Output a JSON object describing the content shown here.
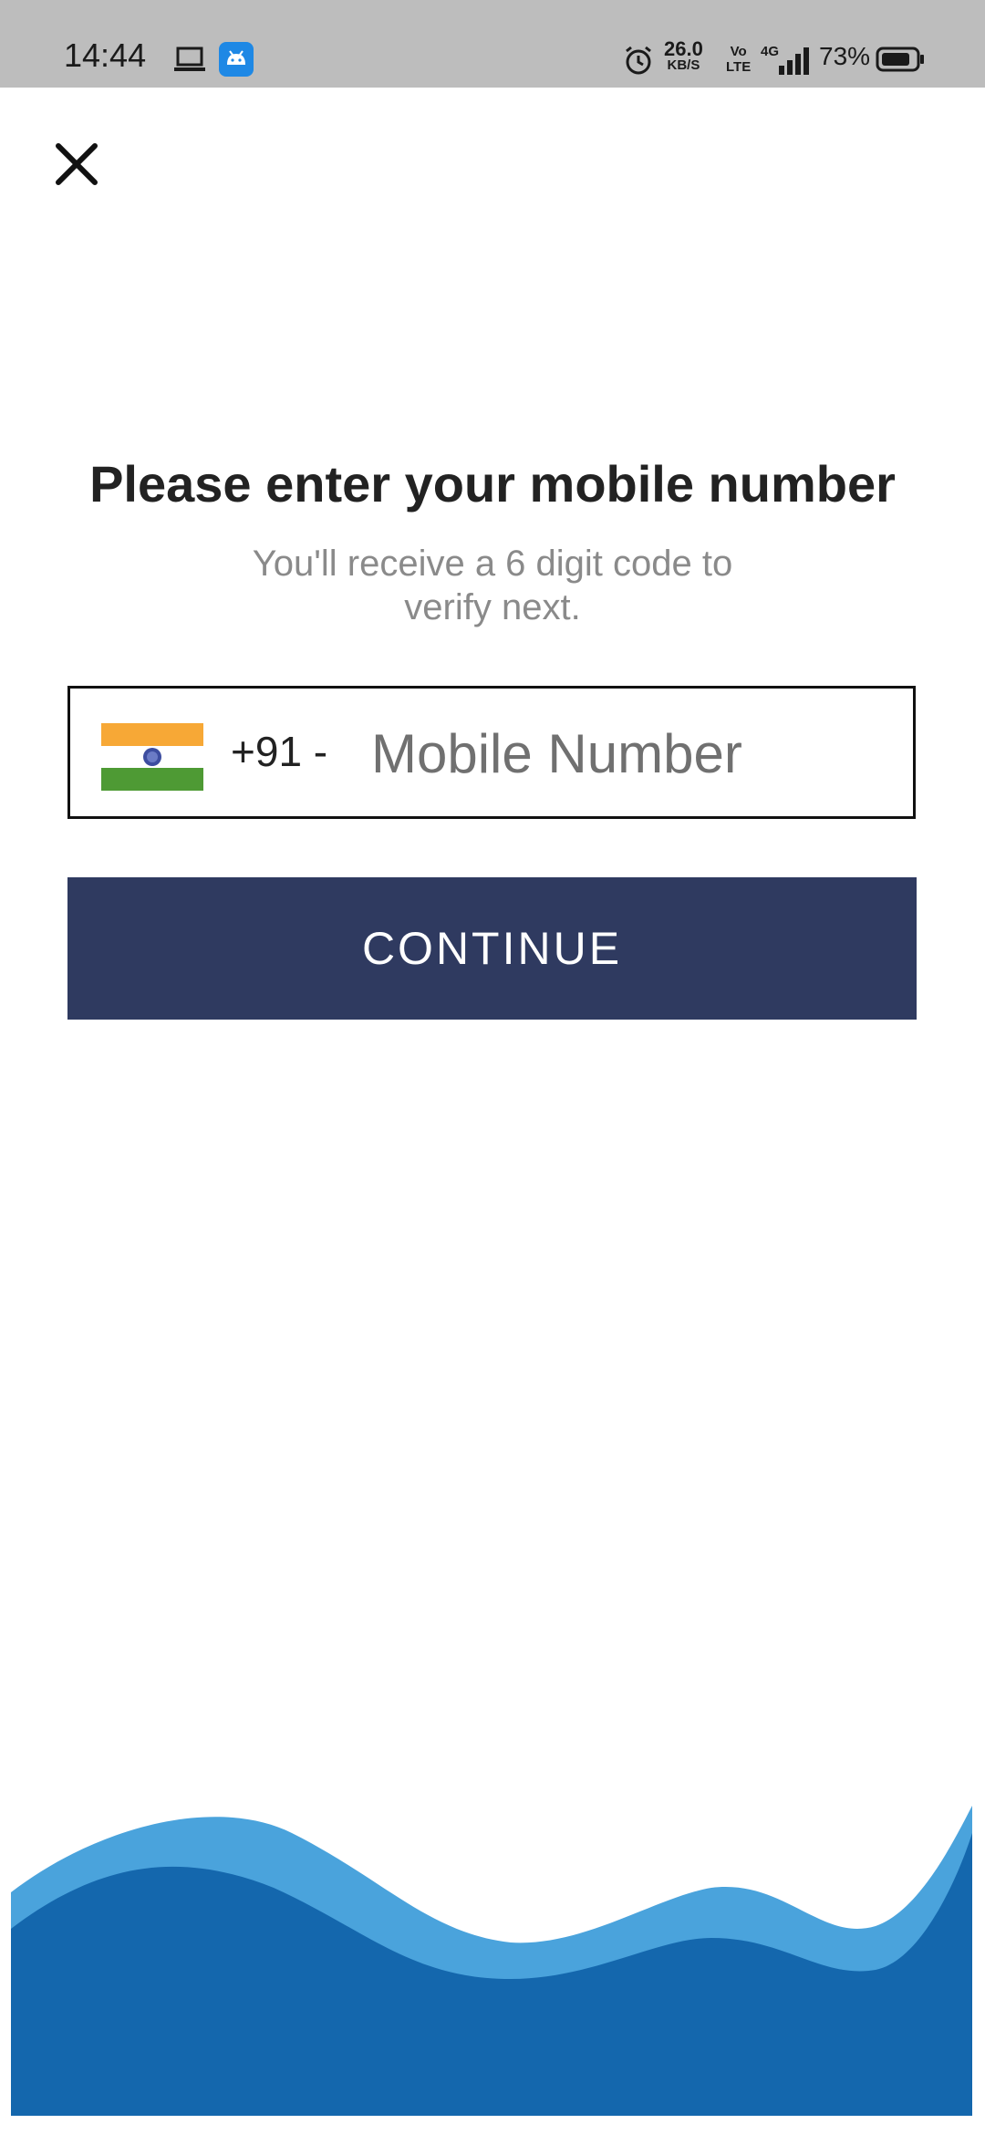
{
  "status_bar": {
    "time": "14:44",
    "speed_value": "26.0",
    "speed_unit": "KB/S",
    "volte_top": "Vo",
    "volte_bottom": "LTE",
    "network": "4G",
    "battery_percent": "73%"
  },
  "login": {
    "title": "Please enter your mobile number",
    "subtitle": "You'll receive a 6 digit code to verify next.",
    "country_code": "+91 -",
    "phone_placeholder": "Mobile Number",
    "phone_value": "",
    "continue_label": "CONTINUE"
  },
  "colors": {
    "status_bar_bg": "#bdbdbd",
    "button_bg": "#2f3a60",
    "wave_light": "#4aa3dc",
    "wave_dark": "#1467ad",
    "flag_saffron": "#f7a836",
    "flag_green": "#4e9a34",
    "flag_chakra": "#3d4da0"
  },
  "icons": {
    "close": "close-icon",
    "flag": "india-flag-icon",
    "laptop": "laptop-icon",
    "app": "android-app-icon",
    "alarm": "alarm-icon",
    "signal": "signal-icon",
    "battery": "battery-icon"
  }
}
